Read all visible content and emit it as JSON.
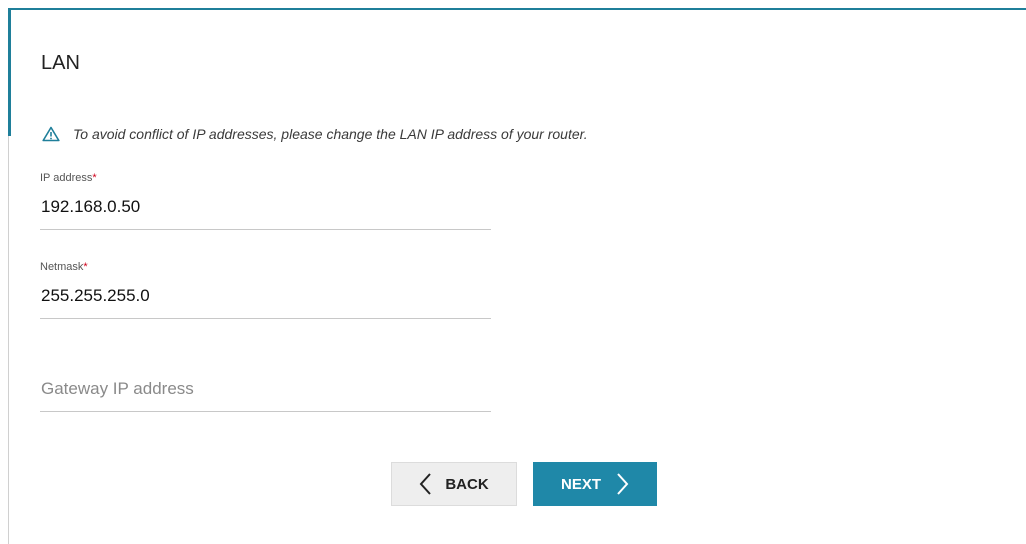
{
  "page": {
    "title": "LAN",
    "warning": "To avoid conflict of IP addresses, please change the LAN IP address of your router."
  },
  "fields": {
    "ip_address": {
      "label": "IP address",
      "required_mark": "*",
      "value": "192.168.0.50"
    },
    "netmask": {
      "label": "Netmask",
      "required_mark": "*",
      "value": "255.255.255.0"
    },
    "gateway": {
      "placeholder": "Gateway IP address",
      "value": ""
    }
  },
  "buttons": {
    "back_label": "BACK",
    "next_label": "NEXT"
  },
  "icons": {
    "warning": "warning-triangle-icon",
    "back": "chevron-left-icon",
    "next": "chevron-right-icon"
  },
  "colors": {
    "accent": "#1f88a8",
    "required": "#d0021b"
  }
}
